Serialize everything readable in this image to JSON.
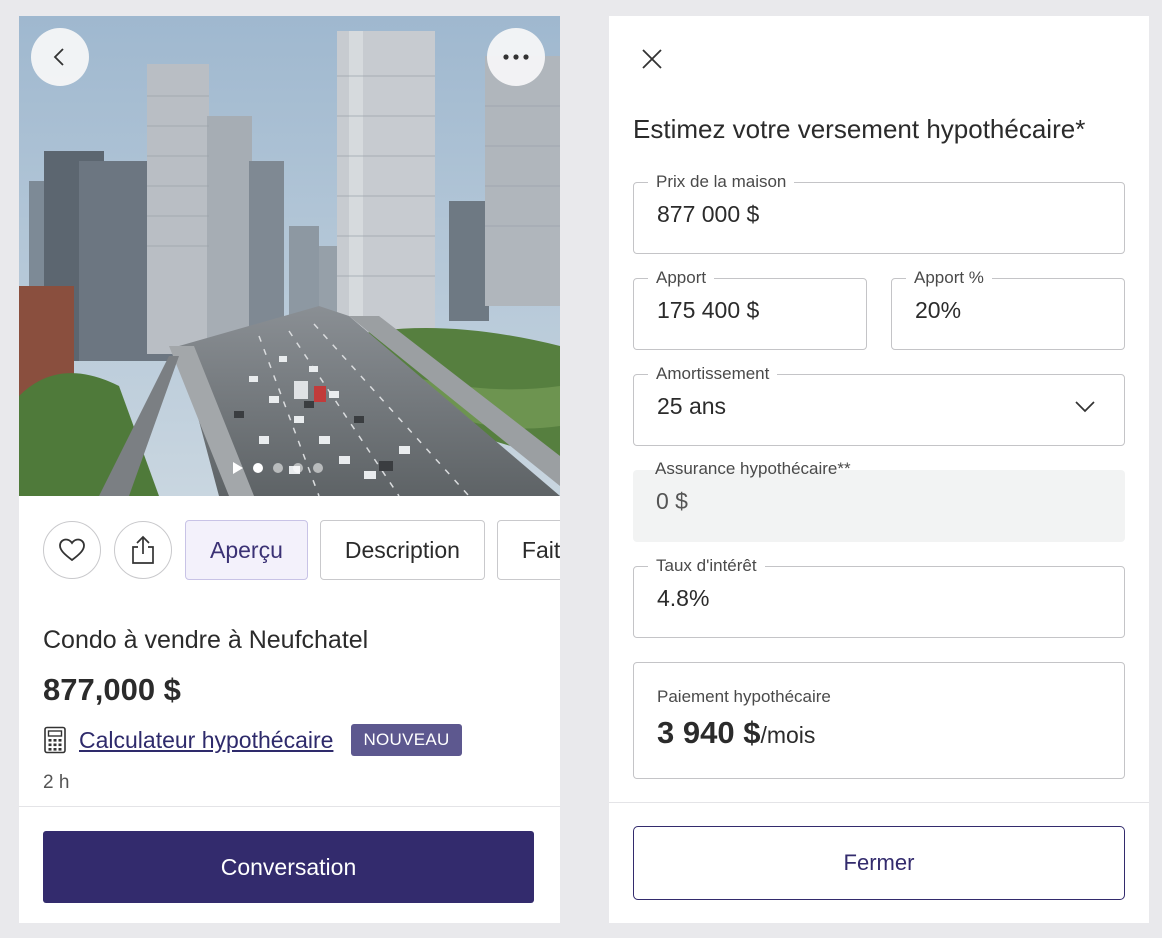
{
  "listing": {
    "tabs": [
      {
        "label": "Aperçu",
        "active": true
      },
      {
        "label": "Description",
        "active": false
      },
      {
        "label": "Fait",
        "active": false
      }
    ],
    "title": "Condo à vendre à Neufchatel",
    "price": "877,000 $",
    "calculator_link": "Calculateur hypothécaire",
    "badge": "NOUVEAU",
    "time": "2 h",
    "cta": "Conversation",
    "icons": [
      "chevron-left-icon",
      "more-horizontal-icon",
      "heart-icon",
      "share-icon",
      "calculator-icon",
      "play-icon"
    ],
    "gallery_dots": 4
  },
  "calculator": {
    "title": "Estimez votre versement hypothécaire*",
    "fields": {
      "home_price": {
        "label": "Prix de la maison",
        "value": "877 000 $"
      },
      "down_payment": {
        "label": "Apport",
        "value": "175 400 $"
      },
      "down_payment_pct": {
        "label": "Apport %",
        "value": "20%"
      },
      "amortization": {
        "label": "Amortissement",
        "value": "25 ans"
      },
      "insurance": {
        "label": "Assurance hypothécaire**",
        "value": "0 $"
      },
      "interest_rate": {
        "label": "Taux d'intérêt",
        "value": "4.8%"
      }
    },
    "result": {
      "label": "Paiement hypothécaire",
      "amount": "3 940 $",
      "unit": "/mois"
    },
    "close_label": "Fermer"
  },
  "colors": {
    "primary": "#332b6d",
    "badge": "#5d588f",
    "active_tab_bg": "#f3f1fb",
    "disabled_field_bg": "#f2f3f3"
  }
}
